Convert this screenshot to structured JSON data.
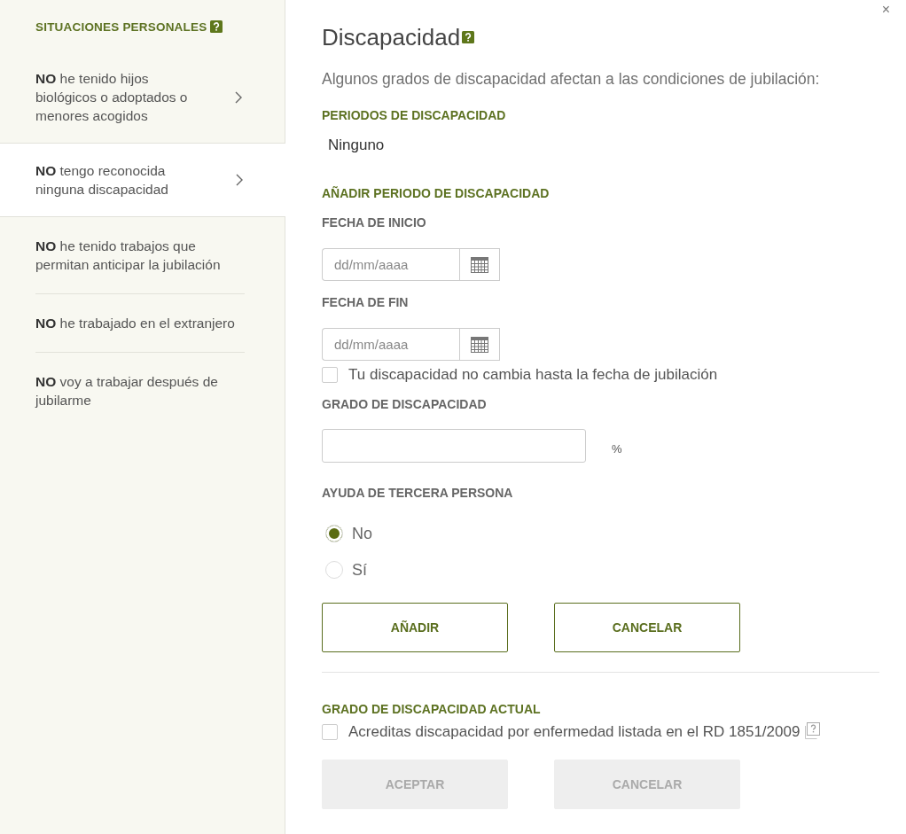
{
  "close": "×",
  "sidebar": {
    "title": "SITUACIONES PERSONALES",
    "items": [
      {
        "kind": "detail",
        "text": "**NO** he tenido hijos biológicos o adoptados o menores acogidos",
        "selected": false
      },
      {
        "kind": "detail",
        "text": "**NO** tengo reconocida ninguna discapacidad",
        "selected": true
      },
      {
        "kind": "simple",
        "text": "**NO** he tenido trabajos que permitan anticipar la jubilación",
        "selected": false
      },
      {
        "kind": "simple",
        "text": "**NO** he trabajado en el extranjero",
        "selected": false
      },
      {
        "kind": "simple",
        "text": "**NO** voy a trabajar después de jubilarme",
        "selected": false
      }
    ]
  },
  "dialog": {
    "title": "Discapacidad",
    "intro": "Algunos grados de discapacidad afectan a las condiciones de jubilación:",
    "periods": {
      "heading": "PERIODOS DE DISCAPACIDAD",
      "value": "Ninguno"
    },
    "add_period": {
      "heading": "AÑADIR PERIODO DE DISCAPACIDAD",
      "fields": [
        {
          "kind": "date",
          "label": "FECHA DE INICIO",
          "placeholder": "dd/mm/aaaa"
        },
        {
          "kind": "date",
          "label": "FECHA DE FIN",
          "placeholder": "dd/mm/aaaa"
        },
        {
          "kind": "checkbox",
          "label": "Tu discapacidad no cambia hasta la fecha de jubilación",
          "checked": false
        },
        {
          "kind": "number",
          "label": "GRADO DE DISCAPACIDAD",
          "unit": "%"
        },
        {
          "kind": "radio",
          "label": "AYUDA DE TERCERA PERSONA",
          "options": [
            {
              "label": "No",
              "selected": true
            },
            {
              "label": "Sí",
              "selected": false
            }
          ]
        }
      ],
      "buttons": [
        {
          "label": "AÑADIR",
          "disabled": false
        },
        {
          "label": "CANCELAR",
          "disabled": false
        }
      ]
    },
    "current": {
      "heading": "GRADO DE DISCAPACIDAD ACTUAL",
      "checkbox": {
        "label": "Acreditas discapacidad por enfermedad listada en el RD 1851/2009",
        "checked": false
      },
      "buttons": [
        {
          "label": "ACEPTAR",
          "disabled": true
        },
        {
          "label": "CANCELAR",
          "disabled": true
        }
      ]
    }
  }
}
